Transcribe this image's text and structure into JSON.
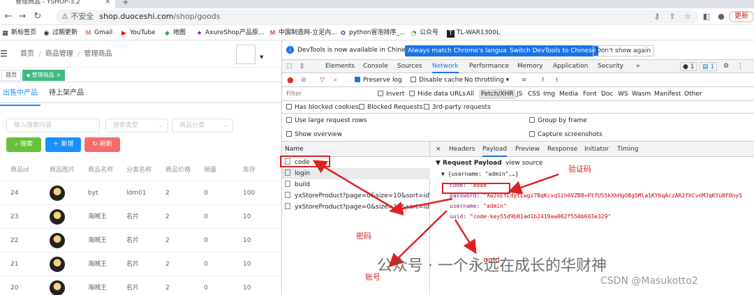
{
  "browser": {
    "tab_title": "管理商品 - YSHOP-3.2",
    "tab_close": "×",
    "new_tab": "+",
    "insecure": "⚠ 不安全",
    "url_host": "shop.duoceshi.com",
    "url_path": "/shop/goods",
    "update_label": "更新",
    "bookmarks": [
      "新标签页",
      "过期更新",
      "Gmail",
      "YouTube",
      "地图",
      "AxureShop产品原...",
      "中国制造网-立足内...",
      "python冒泡排序_...",
      "公众号",
      "TL-WAR1300L"
    ]
  },
  "app": {
    "breadcrumb": [
      "首页",
      "商品管理",
      "管理商品"
    ],
    "tags": [
      "首页",
      "管理商品"
    ],
    "tag_close": "×",
    "tabs": [
      "出售中产品",
      "待上架产品"
    ],
    "search_placeholder": "输入搜索内容",
    "search_type_placeholder": "搜索类型",
    "category_placeholder": "商品分类",
    "search_btn": "搜索",
    "add_btn": "新增",
    "refresh_btn": "刷新",
    "columns": [
      "商品id",
      "商品图片",
      "商品名称",
      "分类名称",
      "商品价格",
      "销量",
      "库存"
    ],
    "rows": [
      [
        "24",
        "",
        "byt",
        "ldm01",
        "2",
        "0",
        "100"
      ],
      [
        "23",
        "",
        "海贼王",
        "名片",
        "2",
        "0",
        "10"
      ],
      [
        "22",
        "",
        "海贼王",
        "名片",
        "2",
        "0",
        "10"
      ],
      [
        "21",
        "",
        "海贼王",
        "名片",
        "2",
        "0",
        "10"
      ],
      [
        "20",
        "",
        "海贼王",
        "名片",
        "2",
        "0",
        "10"
      ]
    ]
  },
  "devtools": {
    "banner_text": "DevTools is now available in Chinese!",
    "banner_btn1": "Always match Chrome's language",
    "banner_btn2": "Switch DevTools to Chinese",
    "banner_btn3": "Don't show again",
    "tabs": [
      "Elements",
      "Console",
      "Sources",
      "Network",
      "Performance",
      "Memory",
      "Application",
      "Security"
    ],
    "more": "»",
    "badge1": "1",
    "badge2": "1",
    "preserve_log": "Preserve log",
    "disable_cache": "Disable cache",
    "throttling": "No throttling",
    "filter_placeholder": "Filter",
    "invert": "Invert",
    "hide_data_urls": "Hide data URLs",
    "filter_types": [
      "All",
      "Fetch/XHR",
      "JS",
      "CSS",
      "Img",
      "Media",
      "Font",
      "Doc",
      "WS",
      "Wasm",
      "Manifest",
      "Other"
    ],
    "blocked_cookies": "Has blocked cookies",
    "blocked_requests": "Blocked Requests",
    "third_party": "3rd-party requests",
    "large_rows": "Use large request rows",
    "group_by_frame": "Group by frame",
    "show_overview": "Show overview",
    "capture_screenshots": "Capture screenshots",
    "name_header": "Name",
    "requests": [
      "code",
      "login",
      "build",
      "yxStoreProduct?page=0&size=10&sort=id%...",
      "yxStoreProduct?page=0&size=10&sort=id%..."
    ],
    "detail_close": "×",
    "detail_tabs": [
      "Headers",
      "Payload",
      "Preview",
      "Response",
      "Initiator",
      "Timing"
    ],
    "payload_title": "▼ Request Payload",
    "view_source": "view source",
    "payload_summary": "▼ {username: \"admin\",…}",
    "payload": [
      {
        "key": "code",
        "value": "\"8888\""
      },
      {
        "key": "password",
        "value": "\"XwJxEfCdytLwgz7BqKcxqSih6VZB8+PtfUS5kXhHgO8g5Mla1KY6qAczAR2fhCvnMJqKYu8F0nyS"
      },
      {
        "key": "username",
        "value": "\"admin\""
      },
      {
        "key": "uuid",
        "value": "\"code-key55d9b01ad1b2419aa002f550b603e329\""
      }
    ]
  },
  "annotations": {
    "captcha": "验证码",
    "password": "密码",
    "uuid": "uuid",
    "account": "账号"
  },
  "watermark": "公众号 · 一个永远在成长的华财神",
  "csdn": "CSDN @Masukotto2",
  "colors": {
    "accent": "#1890ff",
    "green": "#42b983",
    "red": "#e02020",
    "chrome_blue": "#1a73e8"
  }
}
